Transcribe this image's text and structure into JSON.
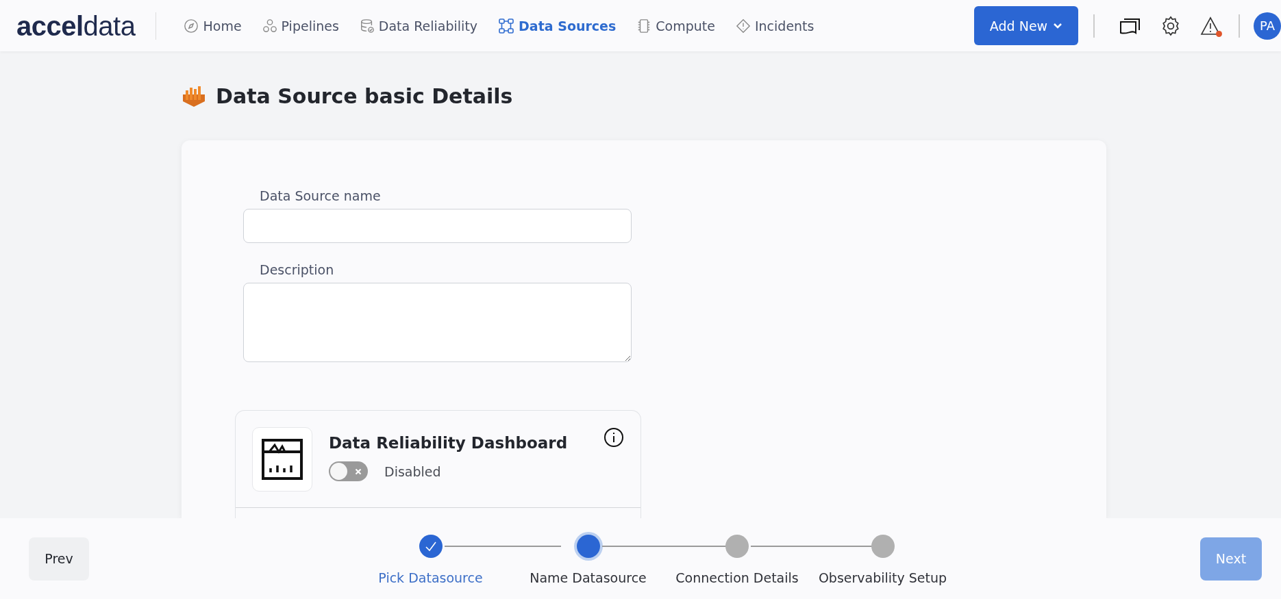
{
  "header": {
    "logo": {
      "bold": "accel",
      "light": "data"
    },
    "nav": [
      {
        "label": "Home",
        "selected": false
      },
      {
        "label": "Pipelines",
        "selected": false
      },
      {
        "label": "Data Reliability",
        "selected": false
      },
      {
        "label": "Data Sources",
        "selected": true
      },
      {
        "label": "Compute",
        "selected": false
      },
      {
        "label": "Incidents",
        "selected": false
      }
    ],
    "add_button": "Add New",
    "alerts_unread": true,
    "avatar": "PA"
  },
  "page_title": "Data Source basic Details",
  "form": {
    "fields": [
      {
        "label": "Data Source name",
        "kind": "input"
      },
      {
        "label": "Description",
        "kind": "textarea"
      }
    ],
    "feature": {
      "title": "Data Reliability Dashboard",
      "on": false,
      "status": "Disabled"
    }
  },
  "footer": {
    "prev": "Prev",
    "next": {
      "label": "Next",
      "disabled": true
    },
    "steps": [
      {
        "label": "Pick Datasource",
        "done": true,
        "selected": false
      },
      {
        "label": "Name Datasource",
        "done": false,
        "selected": true
      },
      {
        "label": "Connection Details",
        "done": false,
        "selected": false
      },
      {
        "label": "Observability Setup",
        "done": false,
        "selected": false
      }
    ]
  }
}
